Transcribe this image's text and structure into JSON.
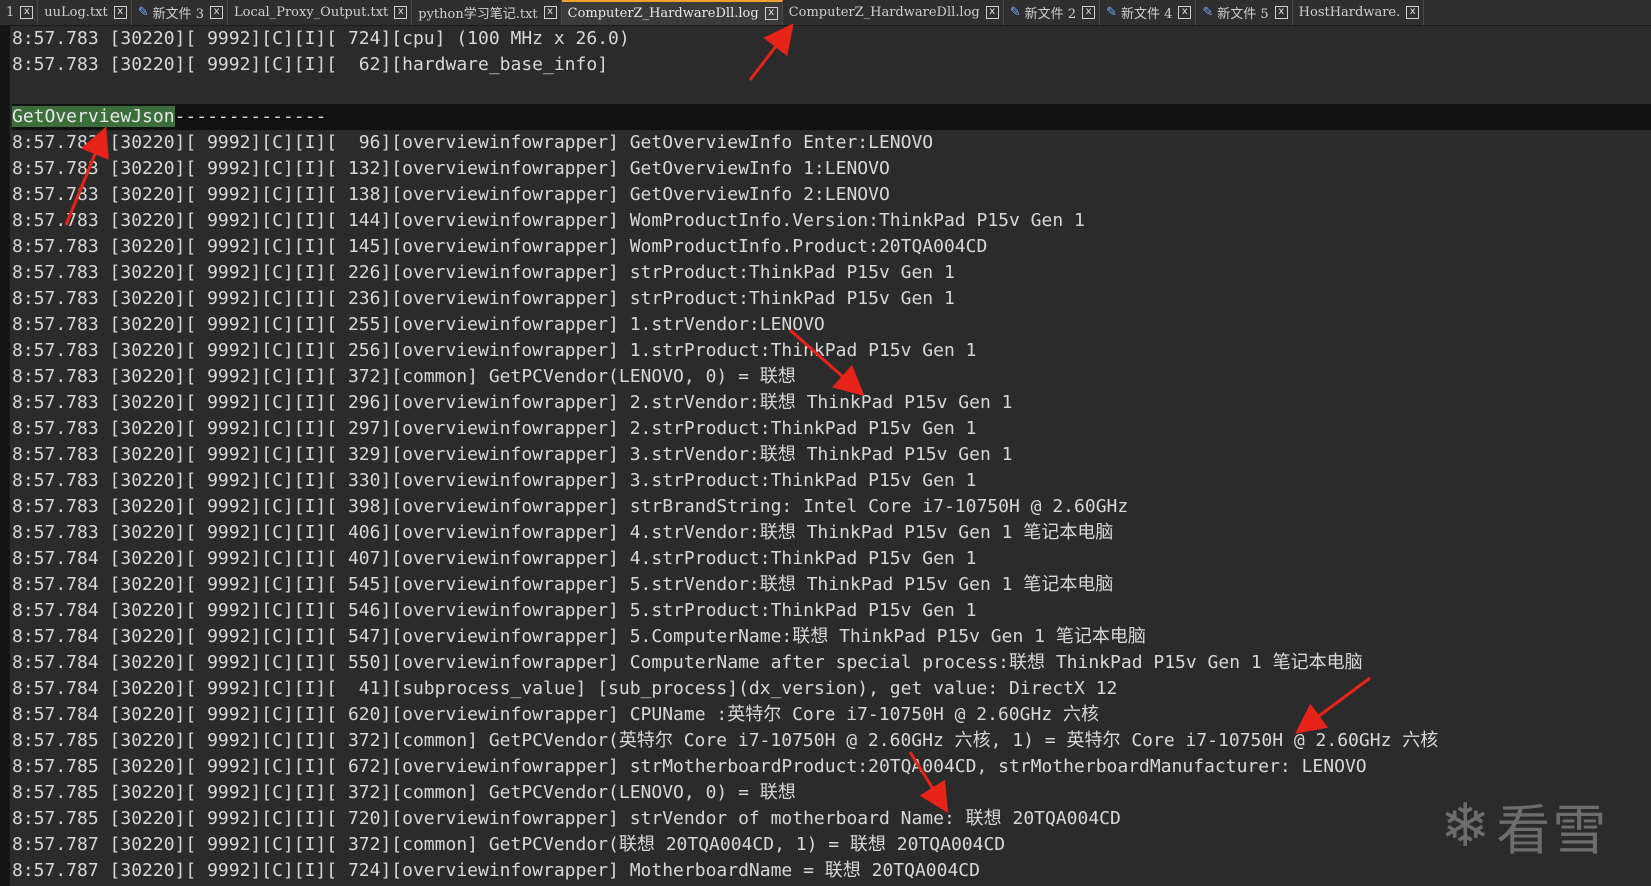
{
  "tabs": [
    {
      "label": "1",
      "modified": false,
      "active": false
    },
    {
      "label": "uuLog.txt",
      "modified": false,
      "active": false
    },
    {
      "label": "新文件 3",
      "modified": true,
      "active": false
    },
    {
      "label": "Local_Proxy_Output.txt",
      "modified": false,
      "active": false
    },
    {
      "label": "python学习笔记.txt",
      "modified": false,
      "active": false
    },
    {
      "label": "ComputerZ_HardwareDll.log",
      "modified": false,
      "active": true
    },
    {
      "label": "ComputerZ_HardwareDll.log",
      "modified": false,
      "active": false
    },
    {
      "label": "新文件 2",
      "modified": true,
      "active": false
    },
    {
      "label": "新文件 4",
      "modified": true,
      "active": false
    },
    {
      "label": "新文件 5",
      "modified": true,
      "active": false
    },
    {
      "label": "HostHardware.",
      "modified": false,
      "active": false
    }
  ],
  "close_glyph": "x",
  "lines": [
    "8:57.783 [30220][ 9992][C][I][ 724][cpu] (100 MHz x 26.0)",
    "8:57.783 [30220][ 9992][C][I][  62][hardware_base_info]",
    "",
    {
      "selected": "GetOverviewJson",
      "rest": "--------------"
    },
    "8:57.783 [30220][ 9992][C][I][  96][overviewinfowrapper] GetOverviewInfo Enter:LENOVO",
    "8:57.783 [30220][ 9992][C][I][ 132][overviewinfowrapper] GetOverviewInfo 1:LENOVO",
    "8:57.783 [30220][ 9992][C][I][ 138][overviewinfowrapper] GetOverviewInfo 2:LENOVO",
    "8:57.783 [30220][ 9992][C][I][ 144][overviewinfowrapper] WomProductInfo.Version:ThinkPad P15v Gen 1",
    "8:57.783 [30220][ 9992][C][I][ 145][overviewinfowrapper] WomProductInfo.Product:20TQA004CD",
    "8:57.783 [30220][ 9992][C][I][ 226][overviewinfowrapper] strProduct:ThinkPad P15v Gen 1",
    "8:57.783 [30220][ 9992][C][I][ 236][overviewinfowrapper] strProduct:ThinkPad P15v Gen 1",
    "8:57.783 [30220][ 9992][C][I][ 255][overviewinfowrapper] 1.strVendor:LENOVO",
    "8:57.783 [30220][ 9992][C][I][ 256][overviewinfowrapper] 1.strProduct:ThinkPad P15v Gen 1",
    "8:57.783 [30220][ 9992][C][I][ 372][common] GetPCVendor(LENOVO, 0) = 联想",
    "8:57.783 [30220][ 9992][C][I][ 296][overviewinfowrapper] 2.strVendor:联想 ThinkPad P15v Gen 1",
    "8:57.783 [30220][ 9992][C][I][ 297][overviewinfowrapper] 2.strProduct:ThinkPad P15v Gen 1",
    "8:57.783 [30220][ 9992][C][I][ 329][overviewinfowrapper] 3.strVendor:联想 ThinkPad P15v Gen 1",
    "8:57.783 [30220][ 9992][C][I][ 330][overviewinfowrapper] 3.strProduct:ThinkPad P15v Gen 1",
    "8:57.783 [30220][ 9992][C][I][ 398][overviewinfowrapper] strBrandString: Intel Core i7-10750H @ 2.60GHz",
    "8:57.783 [30220][ 9992][C][I][ 406][overviewinfowrapper] 4.strVendor:联想 ThinkPad P15v Gen 1 笔记本电脑",
    "8:57.784 [30220][ 9992][C][I][ 407][overviewinfowrapper] 4.strProduct:ThinkPad P15v Gen 1",
    "8:57.784 [30220][ 9992][C][I][ 545][overviewinfowrapper] 5.strVendor:联想 ThinkPad P15v Gen 1 笔记本电脑",
    "8:57.784 [30220][ 9992][C][I][ 546][overviewinfowrapper] 5.strProduct:ThinkPad P15v Gen 1",
    "8:57.784 [30220][ 9992][C][I][ 547][overviewinfowrapper] 5.ComputerName:联想 ThinkPad P15v Gen 1 笔记本电脑",
    "8:57.784 [30220][ 9992][C][I][ 550][overviewinfowrapper] ComputerName after special process:联想 ThinkPad P15v Gen 1 笔记本电脑",
    "8:57.784 [30220][ 9992][C][I][  41][subprocess_value] [sub_process](dx_version), get value: DirectX 12",
    "8:57.784 [30220][ 9992][C][I][ 620][overviewinfowrapper] CPUName :英特尔 Core i7-10750H @ 2.60GHz 六核",
    "8:57.785 [30220][ 9992][C][I][ 372][common] GetPCVendor(英特尔 Core i7-10750H @ 2.60GHz 六核, 1) = 英特尔 Core i7-10750H @ 2.60GHz 六核",
    "8:57.785 [30220][ 9992][C][I][ 672][overviewinfowrapper] strMotherboardProduct:20TQA004CD, strMotherboardManufacturer: LENOVO",
    "8:57.785 [30220][ 9992][C][I][ 372][common] GetPCVendor(LENOVO, 0) = 联想",
    "8:57.785 [30220][ 9992][C][I][ 720][overviewinfowrapper] strVendor of motherboard Name: 联想 20TQA004CD",
    "8:57.787 [30220][ 9992][C][I][ 372][common] GetPCVendor(联想 20TQA004CD, 1) = 联想 20TQA004CD",
    "8:57.787 [30220][ 9992][C][I][ 724][overviewinfowrapper] MotherboardName = 联想 20TQA004CD"
  ],
  "watermark": {
    "icon": "snowflake-icon",
    "text": "看雪"
  },
  "colors": {
    "arrow": "#e8231a",
    "selection": "#3c6e3c",
    "background": "#2b2b2b",
    "text": "#d7d7d7"
  }
}
